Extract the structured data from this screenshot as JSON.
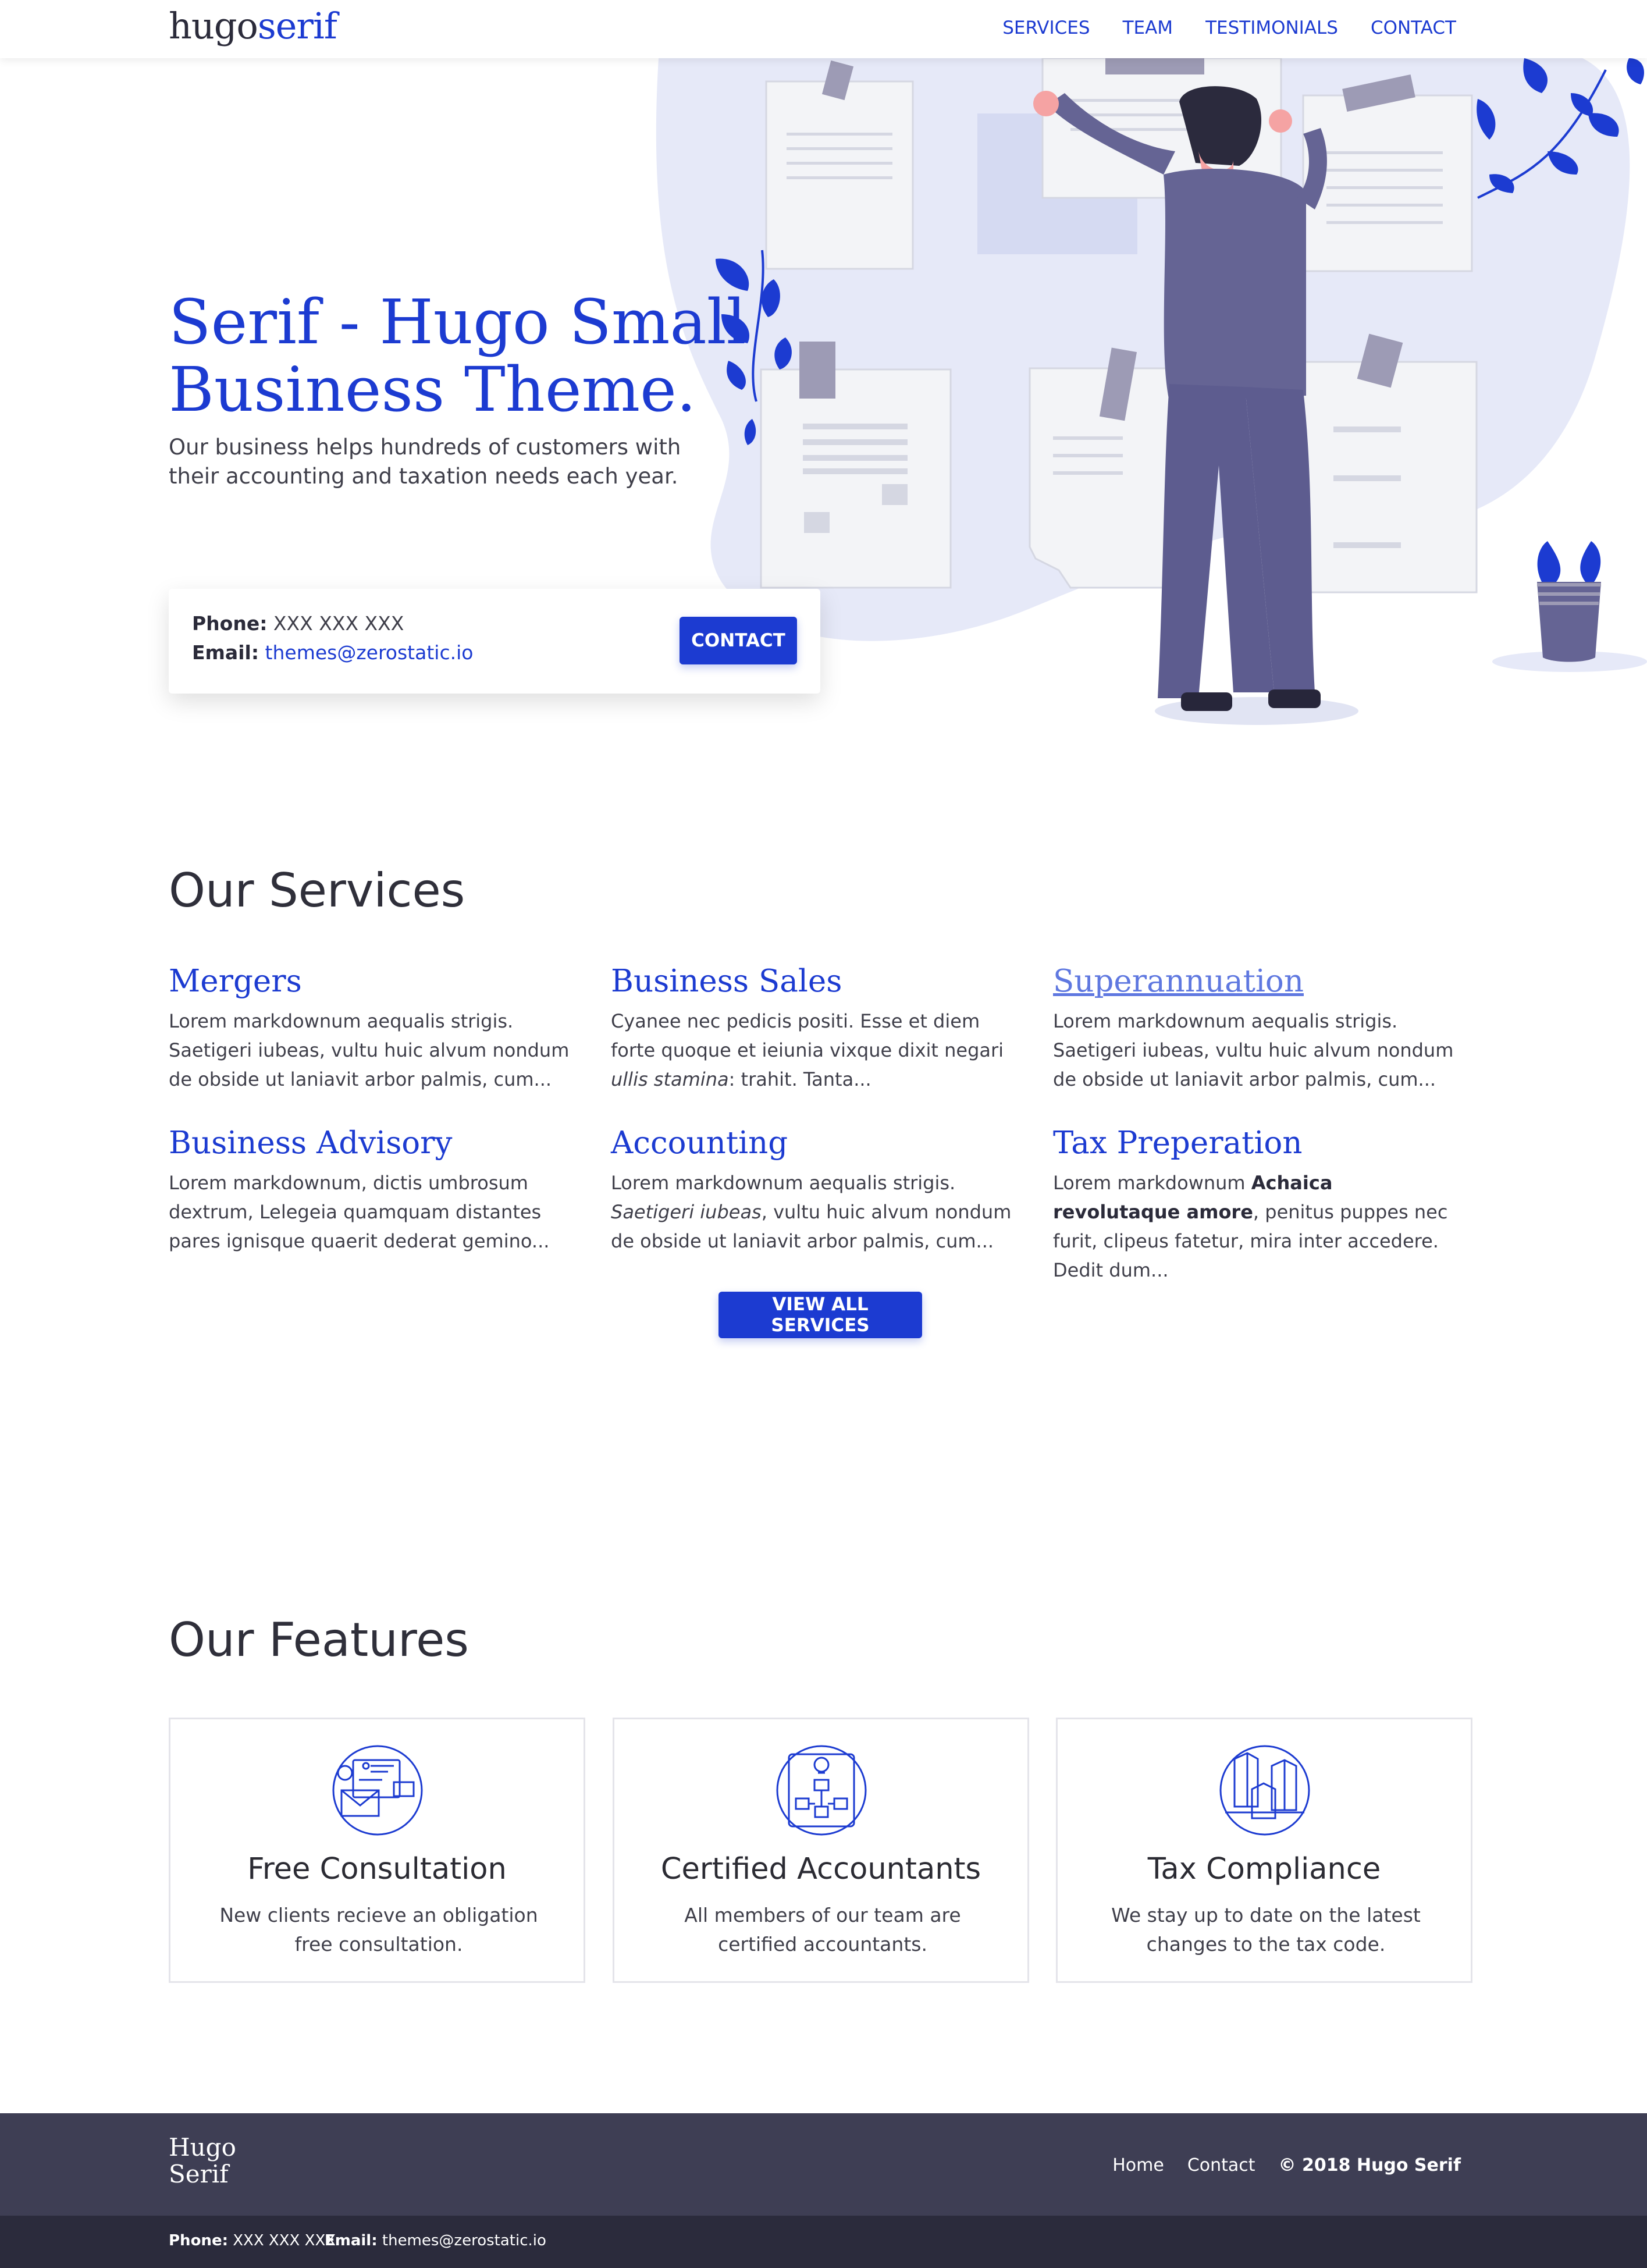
{
  "header": {
    "logo_prefix": "hugo",
    "logo_suffix": "serif",
    "nav": [
      "SERVICES",
      "TEAM",
      "TESTIMONIALS",
      "CONTACT"
    ]
  },
  "hero": {
    "title": "Serif - Hugo Small Business Theme.",
    "subtitle": "Our business helps hundreds of customers with their accounting and taxation needs each year.",
    "contact": {
      "phone_label": "Phone:",
      "phone": "XXX XXX XXX",
      "email_label": "Email:",
      "email": "themes@zerostatic.io",
      "button": "CONTACT"
    }
  },
  "services": {
    "title": "Our Services",
    "items": [
      {
        "title": "Mergers",
        "text": "Lorem markdownum aequalis strigis. Saetigeri iubeas, vultu huic alvum nondum de obside ut laniavit arbor palmis, cum..."
      },
      {
        "title": "Business Sales",
        "text_a": "Cyanee nec pedicis positi. Esse et diem forte quoque et ieiunia vixque dixit negari ",
        "text_em": "ullis stamina",
        "text_b": ": trahit. Tanta..."
      },
      {
        "title": "Superannuation",
        "text": "Lorem markdownum aequalis strigis. Saetigeri iubeas, vultu huic alvum nondum de obside ut laniavit arbor palmis, cum..."
      },
      {
        "title": "Business Advisory",
        "text": "Lorem markdownum, dictis umbrosum dextrum, Lelegeia quamquam distantes pares ignisque quaerit dederat gemino..."
      },
      {
        "title": "Accounting",
        "text_a": "Lorem markdownum aequalis strigis. ",
        "text_em": "Saetigeri iubeas",
        "text_b": ", vultu huic alvum nondum de obside ut laniavit arbor palmis, cum..."
      },
      {
        "title": "Tax Preperation",
        "text_a": "Lorem markdownum ",
        "text_strong": "Achaica revolutaque amore",
        "text_b": ", penitus puppes nec furit, clipeus fatetur, mira inter accedere. Dedit dum..."
      }
    ],
    "button": "VIEW ALL SERVICES"
  },
  "features": {
    "title": "Our Features",
    "items": [
      {
        "icon": "consultation-envelope-icon",
        "title": "Free Consultation",
        "text": "New clients recieve an obligation free consultation."
      },
      {
        "icon": "flowchart-idea-icon",
        "title": "Certified Accountants",
        "text": "All members of our team are certified accountants."
      },
      {
        "icon": "buildings-chart-icon",
        "title": "Tax Compliance",
        "text": "We stay up to date on the latest changes to the tax code."
      }
    ]
  },
  "footer": {
    "logo_line1": "Hugo",
    "logo_line2": "Serif",
    "links": [
      "Home",
      "Contact"
    ],
    "copyright": "© 2018 Hugo Serif",
    "phone_label": "Phone:",
    "phone": "XXX XXX XXX",
    "email_label": "Email:",
    "email": "themes@zerostatic.io"
  },
  "colors": {
    "accent": "#1c3bd1",
    "footer": "#3e3e54",
    "subfooter": "#2b2b3c"
  }
}
